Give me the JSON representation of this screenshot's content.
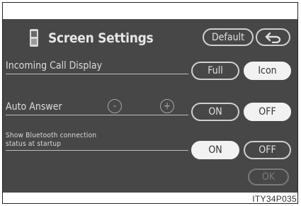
{
  "header": {
    "title": "Screen Settings",
    "default_label": "Default",
    "back_icon": "back-arrow-icon",
    "phone_icon": "phone-icon"
  },
  "rows": {
    "incoming_call": {
      "label": "Incoming Call Display",
      "options": [
        "Full",
        "Icon"
      ],
      "selected": "Icon"
    },
    "auto_answer": {
      "label": "Auto Answer",
      "minus": "-",
      "plus": "+",
      "options": [
        "ON",
        "OFF"
      ],
      "selected": "OFF"
    },
    "bluetooth_status": {
      "label_line1": "Show Bluetooth connection",
      "label_line2": "status at startup",
      "options": [
        "ON",
        "OFF"
      ],
      "selected": "ON"
    }
  },
  "ok_label": "OK",
  "figure_code": "ITY34P035",
  "colors": {
    "screen_bg": "#474747",
    "selected_bg": "#f2f2f2",
    "text": "#e0e0e0"
  }
}
